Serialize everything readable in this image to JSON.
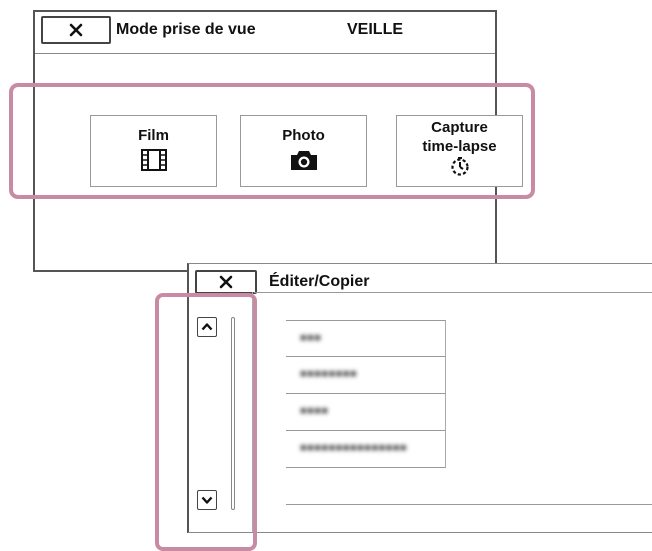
{
  "shoot_mode_screen": {
    "close_icon": "close-x-icon",
    "title": "Mode prise de vue",
    "status": "VEILLE",
    "modes": [
      {
        "label": "Film",
        "icon": "film-strip-icon"
      },
      {
        "label": "Photo",
        "icon": "camera-icon"
      },
      {
        "label_line1": "Capture",
        "label_line2": "time-lapse",
        "icon": "time-lapse-icon"
      }
    ],
    "highlight_color": "#c98aa3"
  },
  "edit_screen": {
    "close_icon": "close-x-icon",
    "title": "Éditer/Copier",
    "scroll_up_icon": "chevron-up-icon",
    "scroll_down_icon": "chevron-down-icon",
    "items": [
      "■■■",
      "■■■■■■■■",
      "■■■■",
      "■■■■■■■■■■■■■■■",
      ""
    ]
  }
}
